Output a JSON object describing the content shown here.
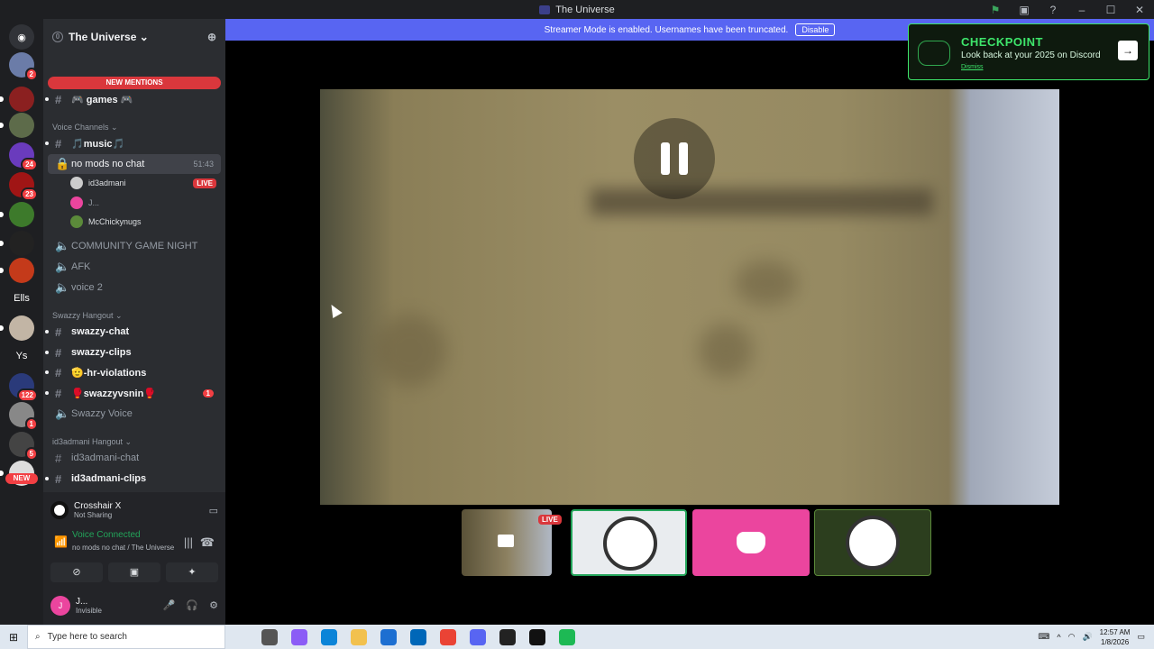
{
  "window": {
    "title": "The Universe"
  },
  "banner": {
    "text": "Streamer Mode is enabled. Usernames have been truncated.",
    "button": "Disable"
  },
  "guild": {
    "name": "The Universe ⌄",
    "new_mentions": "NEW MENTIONS"
  },
  "server_badges": {
    "s1": "2",
    "s4": "24",
    "s5": "23",
    "s_els": "Ells",
    "s_ys": "Ys",
    "s_122": "122",
    "s_1": "1",
    "s_5": "5",
    "new": "NEW"
  },
  "channels": {
    "games": "🎮 games 🎮",
    "cat_voice": "Voice Channels ⌄",
    "music": "🎵music🎵",
    "nomods": "no mods no chat",
    "nomods_time": "51:43",
    "user1": "id3admani",
    "user1_live": "LIVE",
    "user2": "J...",
    "user3": "McChickynugs",
    "community": "COMMUNITY GAME NIGHT",
    "afk": "AFK",
    "voice2": "voice 2",
    "cat_swazzy": "Swazzy Hangout ⌄",
    "swazzy_chat": "swazzy-chat",
    "swazzy_clips": "swazzy-clips",
    "hr": "🫡-hr-violations",
    "swazzyvs": "🥊swazzyvsnin🥊",
    "swazzyvs_count": "1",
    "swazzy_voice": "Swazzy Voice",
    "cat_id3": "id3admani Hangout ⌄",
    "id3_chat": "id3admani-chat",
    "id3_clips": "id3admani-clips"
  },
  "panel": {
    "game_name": "Crosshair X",
    "game_status": "Not Sharing",
    "vc_status": "Voice Connected",
    "vc_location": "no mods no chat / The Universe",
    "user_name": "J...",
    "user_status": "Invisible",
    "user_avatar": "J"
  },
  "stream": {
    "live": "LIVE"
  },
  "checkpoint": {
    "title": "CHECKPOINT",
    "subtitle": "Look back at your 2025 on Discord",
    "dismiss": "Dismiss"
  },
  "taskbar": {
    "search_placeholder": "Type here to search",
    "time": "12:57 AM",
    "date": "1/8/2026"
  }
}
